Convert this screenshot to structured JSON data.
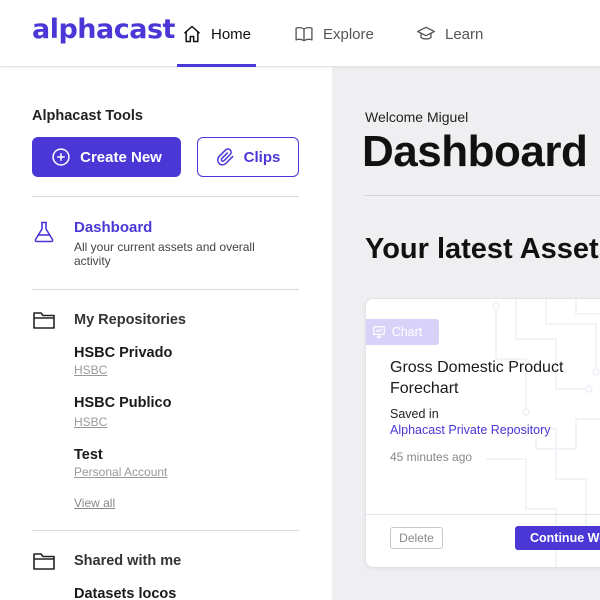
{
  "brand": {
    "logo": "alphacast",
    "accent": "#4b37d6"
  },
  "nav": {
    "items": [
      {
        "label": "Home",
        "icon": "home-icon",
        "active": true
      },
      {
        "label": "Explore",
        "icon": "book-icon",
        "active": false
      },
      {
        "label": "Learn",
        "icon": "graduation-cap-icon",
        "active": false
      }
    ]
  },
  "sidebar": {
    "tools_title": "Alphacast Tools",
    "create_label": "Create New",
    "clips_label": "Clips",
    "dashboard": {
      "label": "Dashboard",
      "description": "All your current assets and overall activity"
    },
    "repositories": {
      "title": "My Repositories",
      "items": [
        {
          "name": "HSBC Privado",
          "sub": "HSBC"
        },
        {
          "name": "HSBC Publico",
          "sub": "HSBC"
        },
        {
          "name": "Test",
          "sub": "Personal Account"
        }
      ],
      "view_all": "View all"
    },
    "shared": {
      "title": "Shared with me",
      "items": [
        {
          "name": "Datasets locos"
        }
      ]
    }
  },
  "main": {
    "welcome": "Welcome Miguel",
    "title": "Dashboard",
    "latest_title": "Your latest Assets",
    "card": {
      "badge": "Chart",
      "title": "Gross Domestic Product Forechart",
      "saved_in_label": "Saved in",
      "repository": "Alphacast Private Repository",
      "time": "45 minutes ago",
      "delete_label": "Delete",
      "continue_label": "Continue Working"
    }
  }
}
